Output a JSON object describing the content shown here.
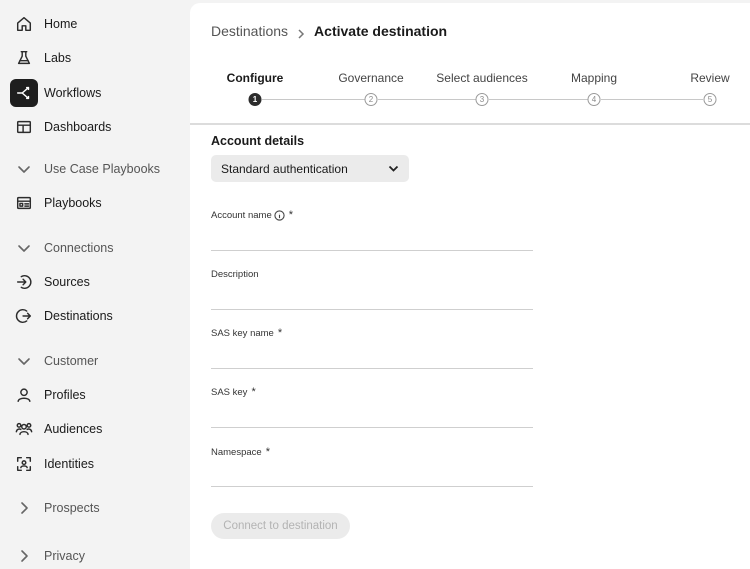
{
  "sidebar": {
    "items": [
      {
        "label": "Home"
      },
      {
        "label": "Labs"
      },
      {
        "label": "Workflows"
      },
      {
        "label": "Dashboards"
      },
      {
        "label": "Use Case Playbooks"
      },
      {
        "label": "Playbooks"
      },
      {
        "label": "Connections"
      },
      {
        "label": "Sources"
      },
      {
        "label": "Destinations"
      },
      {
        "label": "Customer"
      },
      {
        "label": "Profiles"
      },
      {
        "label": "Audiences"
      },
      {
        "label": "Identities"
      },
      {
        "label": "Prospects"
      },
      {
        "label": "Privacy"
      }
    ]
  },
  "breadcrumb": {
    "parent": "Destinations",
    "current": "Activate destination"
  },
  "stepper": {
    "steps": [
      {
        "label": "Configure",
        "number": "1"
      },
      {
        "label": "Governance",
        "number": "2"
      },
      {
        "label": "Select audiences",
        "number": "3"
      },
      {
        "label": "Mapping",
        "number": "4"
      },
      {
        "label": "Review",
        "number": "5"
      }
    ]
  },
  "form": {
    "section_title": "Account details",
    "auth_dropdown": {
      "selected": "Standard authentication"
    },
    "fields": [
      {
        "label": "Account name",
        "required_mark": "*",
        "value": ""
      },
      {
        "label": "Description",
        "value": ""
      },
      {
        "label": "SAS key name",
        "required_mark": "*",
        "value": ""
      },
      {
        "label": "SAS key",
        "required_mark": "*",
        "value": ""
      },
      {
        "label": "Namespace",
        "required_mark": "*",
        "value": ""
      }
    ],
    "submit_label": "Connect to destination"
  },
  "colors": {
    "sidebar_bg": "#f3f3f3",
    "active_nav_bg": "#1e1e1e",
    "main_bg": "#ffffff",
    "disabled_button_text": "#b3b3b3"
  }
}
